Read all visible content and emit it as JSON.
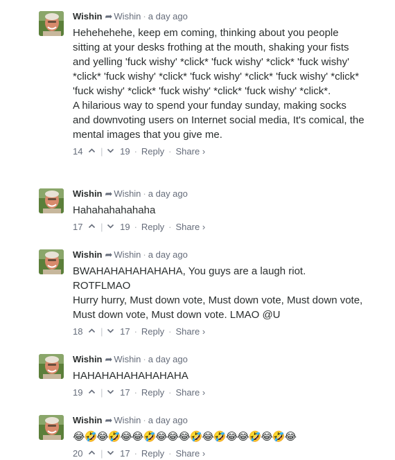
{
  "comments": [
    {
      "author": "Wishin",
      "parent_author": "Wishin",
      "timestamp": "a day ago",
      "lines": [
        "Hehehehehe, keep em coming, thinking about you people sitting at your desks frothing at the mouth, shaking your fists and yelling 'fuck wishy' *click* 'fuck wishy' *click* 'fuck wishy' *click* 'fuck wishy' *click* 'fuck wishy' *click* 'fuck wishy' *click* 'fuck wishy' *click* 'fuck wishy' *click* 'fuck wishy' *click*.",
        "A hilarious way to spend your funday sunday, making socks and downvoting users on Internet social media, It's comical, the mental images that you give me."
      ],
      "upvotes": "14",
      "downvotes": "19",
      "reply_label": "Reply",
      "share_label": "Share ›"
    },
    {
      "author": "Wishin",
      "parent_author": "Wishin",
      "timestamp": "a day ago",
      "lines": [
        "Hahahahahahaha"
      ],
      "upvotes": "17",
      "downvotes": "19",
      "reply_label": "Reply",
      "share_label": "Share ›"
    },
    {
      "author": "Wishin",
      "parent_author": "Wishin",
      "timestamp": "a day ago",
      "lines": [
        "BWAHAHAHAHAHAHA, You guys are a laugh riot. ROTFLMAO",
        "Hurry hurry, Must down vote, Must down vote, Must down vote, Must down vote, Must down vote. LMAO @U"
      ],
      "upvotes": "18",
      "downvotes": "17",
      "reply_label": "Reply",
      "share_label": "Share ›"
    },
    {
      "author": "Wishin",
      "parent_author": "Wishin",
      "timestamp": "a day ago",
      "lines": [
        "HAHAHAHAHAHAHAHA"
      ],
      "upvotes": "19",
      "downvotes": "17",
      "reply_label": "Reply",
      "share_label": "Share ›"
    },
    {
      "author": "Wishin",
      "parent_author": "Wishin",
      "timestamp": "a day ago",
      "lines": [
        "😂🤣😂🤣😂😂🤣😂😂😂🤣😂🤣😂😂🤣😂🤣😂"
      ],
      "upvotes": "20",
      "downvotes": "17",
      "reply_label": "Reply",
      "share_label": "Share ›"
    }
  ],
  "meta_separator": "·",
  "vote_separator": "|"
}
